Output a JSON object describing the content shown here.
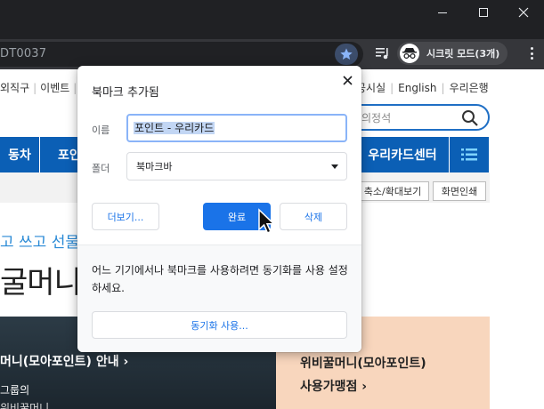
{
  "browser": {
    "url_fragment": "DT0037",
    "incognito_label": "시크릿 모드(3개)"
  },
  "page": {
    "util_links_left": [
      "외직구",
      "이벤트"
    ],
    "util_links_right": [
      "공시실",
      "English",
      "우리은행"
    ],
    "search_text": "의정석",
    "nav": [
      "동차",
      "포인",
      "우리카드센터"
    ],
    "zoom_chip": "축소/확대보기",
    "print_chip": "화면인쇄",
    "promo_blue": "고 쓰고 선물하",
    "promo_big": "굴머니(모",
    "photo_title": "머니(모아포인트) 안내 ›",
    "photo_sub1": "그룹의",
    "photo_sub2": "위비꿀머니",
    "peach_line1": "위비꿀머니(모아포인트)",
    "peach_line2": "사용가맹점 ›"
  },
  "bookmark_bubble": {
    "title": "북마크 추가됨",
    "name_label": "이름",
    "name_value": "포인트 - 우리카드",
    "folder_label": "폴더",
    "folder_value": "북마크바",
    "more_button": "더보기...",
    "done_button": "완료",
    "delete_button": "삭제",
    "sync_message": "어느 기기에서나 북마크를 사용하려면 동기화를 사용 설정하세요.",
    "sync_button": "동기화 사용..."
  },
  "colors": {
    "chrome_dark": "#202124",
    "toolbar": "#35363a",
    "accent_blue": "#1a73e8",
    "nav_blue": "#0b5fb5",
    "peach": "#f8d6bd"
  }
}
